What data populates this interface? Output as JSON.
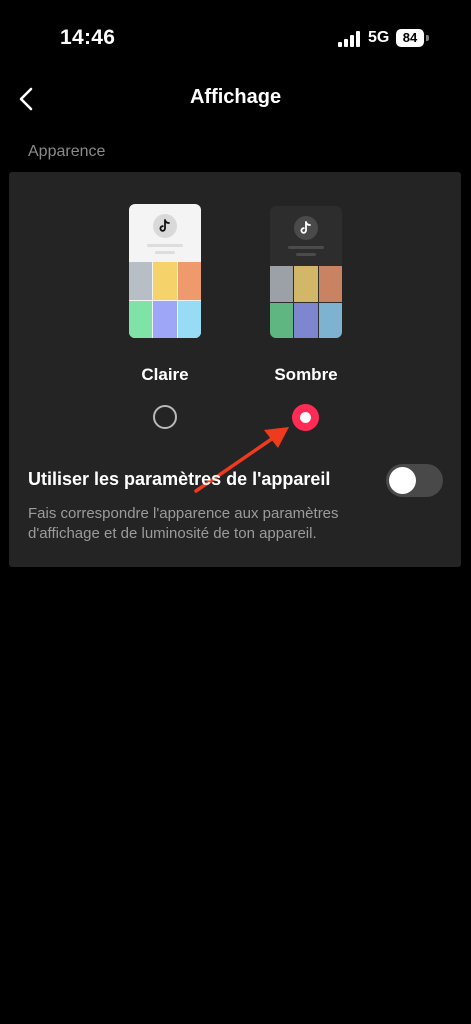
{
  "status_bar": {
    "time": "14:46",
    "network": "5G",
    "battery": "84"
  },
  "header": {
    "title": "Affichage",
    "back_icon": "chevron-left-icon"
  },
  "appearance": {
    "section_label": "Apparence",
    "options": [
      {
        "label": "Claire",
        "selected": false,
        "preview_bg": "#f4f4f4",
        "tile_colors": [
          "#b8bec6",
          "#f5d36a",
          "#ef9a6d",
          "#7fe3a7",
          "#9ea6f7",
          "#97dcf4"
        ]
      },
      {
        "label": "Sombre",
        "selected": true,
        "preview_bg": "#2d2d2d",
        "tile_colors": [
          "#9ca1a8",
          "#d2b768",
          "#c98362",
          "#5fb681",
          "#7d86cf",
          "#7eb2d1"
        ]
      }
    ],
    "accent_color": "#fe2c55"
  },
  "device_settings": {
    "title": "Utiliser les paramètres de l'appareil",
    "description": "Fais correspondre l'apparence aux paramètres d'affichage et de luminosité de ton appareil.",
    "toggle_on": false
  }
}
